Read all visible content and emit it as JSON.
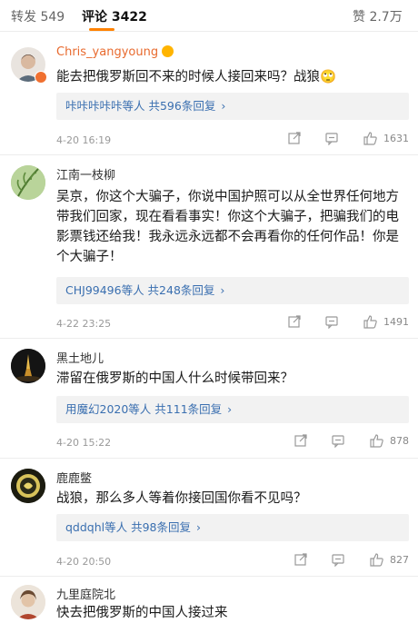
{
  "tabs": {
    "repost": "转发 549",
    "comments": "评论 3422",
    "likes": "赞 2.7万"
  },
  "comments": [
    {
      "username": "Chris_yangyoung",
      "text": "能去把俄罗斯回不来的时候人接回来吗？战狼🙄",
      "reply_summary": "咔咔咔咔咔等人 共596条回复",
      "time": "4-20 16:19",
      "likes": "1631"
    },
    {
      "username": "江南一枝柳",
      "text": "吴京，你这个大骗子，你说中国护照可以从全世界任何地方带我们回家，现在看看事实！你这个大骗子，把骗我们的电影票钱还给我！我永远永远都不会再看你的任何作品！你是个大骗子！",
      "reply_summary": "CHJ99496等人 共248条回复",
      "time": "4-22 23:25",
      "likes": "1491"
    },
    {
      "username": "黑土地儿",
      "text": "滞留在俄罗斯的中国人什么时候带回来？",
      "reply_summary": "用魔幻2020等人 共111条回复",
      "time": "4-20 15:22",
      "likes": "878"
    },
    {
      "username": "鹿鹿鳖",
      "text": "战狼，那么多人等着你接回国你看不见吗？",
      "reply_summary": "qddqhl等人 共98条回复",
      "time": "4-20 20:50",
      "likes": "827"
    },
    {
      "username": "九里庭院北",
      "text": "快去把俄罗斯的中国人接过来"
    }
  ],
  "chevron": "›",
  "colors": {
    "accent": "#ff8200",
    "username_vip": "#e86a2e",
    "reply_link": "#3a6fb0",
    "reply_bg": "#f2f2f2"
  }
}
